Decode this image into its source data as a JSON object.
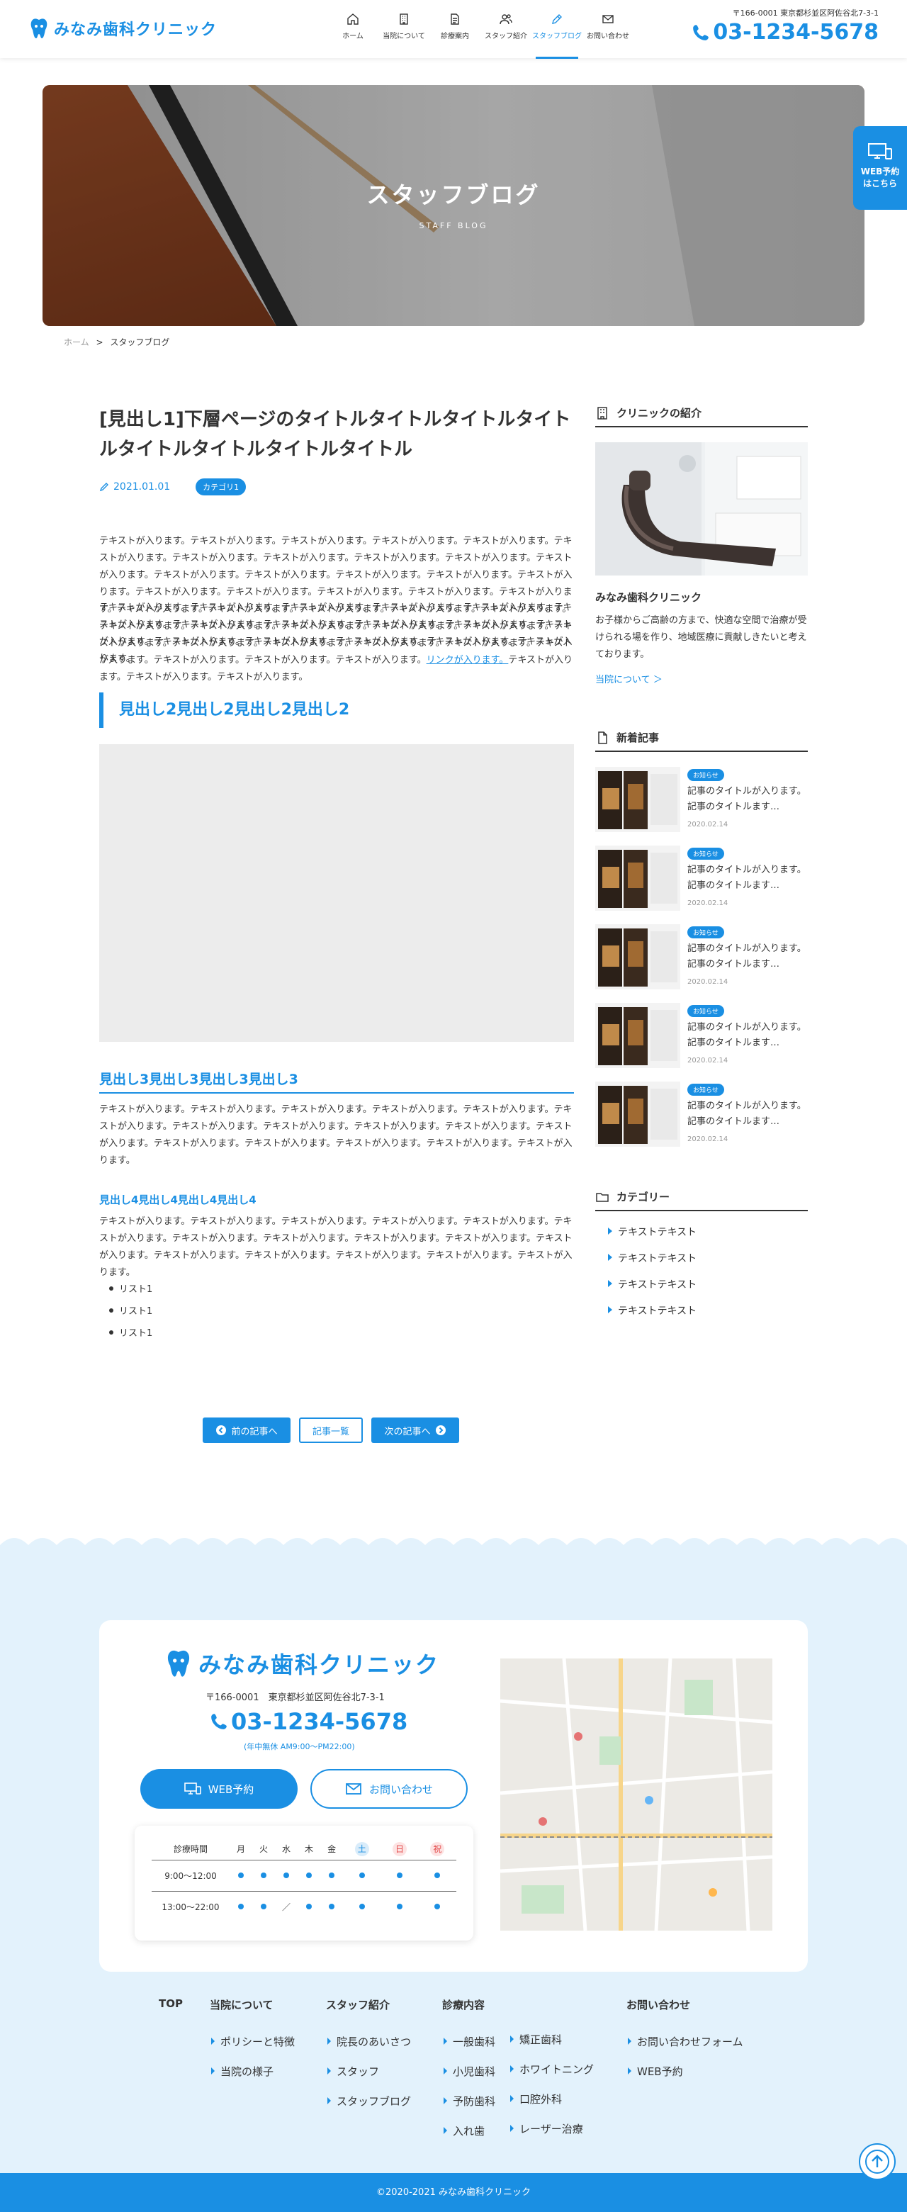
{
  "header": {
    "logo_text": "みなみ歯科クリニック",
    "nav": [
      {
        "label": "ホーム",
        "icon": "home-icon"
      },
      {
        "label": "当院について",
        "icon": "building-icon"
      },
      {
        "label": "診療案内",
        "icon": "document-icon"
      },
      {
        "label": "スタッフ紹介",
        "icon": "users-icon"
      },
      {
        "label": "スタッフブログ",
        "icon": "pen-icon",
        "active": true
      },
      {
        "label": "お問い合わせ",
        "icon": "mail-icon"
      }
    ],
    "address": "〒166-0001 東京都杉並区阿佐谷北7-3-1",
    "tel": "03-1234-5678"
  },
  "web_tab": {
    "line1": "WEB予約",
    "line2": "はこちら"
  },
  "hero": {
    "title": "スタッフブログ",
    "subtitle": "STAFF BLOG"
  },
  "breadcrumb": {
    "home": "ホーム",
    "sep": ">",
    "current": "スタッフブログ"
  },
  "article": {
    "title": "[見出し1]下層ページのタイトルタイトルタイトルタイトルタイトルタイトルタイトルタイトル",
    "date": "2021.01.01",
    "category": "カテゴリ1",
    "para1_a": "テキストが入ります。テキストが入ります。テキストが入ります。テキストが入ります。テキストが入ります。テキストが入ります。テキストが入ります。テキストが入ります。テキストが入ります。テキストが入ります。テキストが入ります。テキストが入ります。テキストが入ります。テキストが入ります。テキストが入ります。テキストが入ります。テキストが入ります。テキストが入ります。テキストが入ります。テキストが入ります。テキストが入ります。テキストが入ります。テキストが入ります。テキストが入ります。テキストが入ります。テキストが入ります。テキストが入ります。テキストが入ります。テキストが入ります。テキストが入ります。テキストが入ります。テキストが入ります。テキストが入ります。テキストが入ります。テキストが入ります。テキストが入ります。テキストが入ります。テキストが入ります。テキストが入ります。テキストが入ります。",
    "link_text": "リンクが入ります。",
    "para1_b": "テキストが入ります。テキストが入ります。テキストが入ります。",
    "para2": "テキストが入ります。テキストが入ります。テキストが入ります。テキストが入ります。テキストが入ります。テキストが入ります。テキストが入ります。テキストが入ります。テキストが入ります。テキストが入ります。テキストが入ります。テキストが入ります。テキストが入ります。テキストが入ります。テキストが入ります。テキストが入ります。",
    "h2": "見出し2見出し2見出し2見出し2",
    "h3": "見出し3見出し3見出し3見出し3",
    "para3": "テキストが入ります。テキストが入ります。テキストが入ります。テキストが入ります。テキストが入ります。テキストが入ります。テキストが入ります。テキストが入ります。テキストが入ります。テキストが入ります。テキストが入ります。テキストが入ります。テキストが入ります。テキストが入ります。テキストが入ります。テキストが入ります。",
    "h4": "見出し4見出し4見出し4見出し4",
    "para4": "テキストが入ります。テキストが入ります。テキストが入ります。テキストが入ります。テキストが入ります。テキストが入ります。テキストが入ります。テキストが入ります。テキストが入ります。テキストが入ります。テキストが入ります。テキストが入ります。テキストが入ります。テキストが入ります。テキストが入ります。テキストが入ります。",
    "list": [
      "リスト1",
      "リスト1",
      "リスト1"
    ]
  },
  "pager": {
    "prev": "前の記事へ",
    "list": "記事一覧",
    "next": "次の記事へ"
  },
  "sidebar": {
    "clinic_heading": "クリニックの紹介",
    "clinic_name": "みなみ歯科クリニック",
    "clinic_desc": "お子様からご高齢の方まで、快適な空間で治療が受けられる場を作り、地域医療に貢献しきたいと考えております。",
    "clinic_link": "当院について ＞",
    "news_heading": "新着記事",
    "news": [
      {
        "badge": "お知らせ",
        "title": "記事のタイトルが入ります。記事のタイトルます…",
        "date": "2020.02.14"
      },
      {
        "badge": "お知らせ",
        "title": "記事のタイトルが入ります。記事のタイトルます…",
        "date": "2020.02.14"
      },
      {
        "badge": "お知らせ",
        "title": "記事のタイトルが入ります。記事のタイトルます…",
        "date": "2020.02.14"
      },
      {
        "badge": "お知らせ",
        "title": "記事のタイトルが入ります。記事のタイトルます…",
        "date": "2020.02.14"
      },
      {
        "badge": "お知らせ",
        "title": "記事のタイトルが入ります。記事のタイトルます…",
        "date": "2020.02.14"
      }
    ],
    "cat_heading": "カテゴリー",
    "categories": [
      "テキストテキスト",
      "テキストテキスト",
      "テキストテキスト",
      "テキストテキスト"
    ]
  },
  "footer": {
    "logo_text": "みなみ歯科クリニック",
    "address": "〒166-0001　東京都杉並区阿佐谷北7-3-1",
    "tel": "03-1234-5678",
    "hours_note": "(年中無休 AM9:00〜PM22:00)",
    "web_button": "WEB予約",
    "contact_button": "お問い合わせ",
    "table_headers": [
      "診療時間",
      "月",
      "火",
      "水",
      "木",
      "金",
      "土",
      "日",
      "祝"
    ],
    "rows": [
      {
        "time": "9:00〜12:00",
        "cells": [
          "●",
          "●",
          "●",
          "●",
          "●",
          "●",
          "●",
          "●"
        ]
      },
      {
        "time": "13:00〜22:00",
        "cells": [
          "●",
          "●",
          "／",
          "●",
          "●",
          "●",
          "●",
          "●"
        ]
      }
    ],
    "nav": {
      "top": "TOP",
      "about": {
        "heading": "当院について",
        "items": [
          "ポリシーと特徴",
          "当院の様子"
        ]
      },
      "staff": {
        "heading": "スタッフ紹介",
        "items": [
          "院長のあいさつ",
          "スタッフ",
          "スタッフブログ"
        ]
      },
      "treatment": {
        "heading": "診療内容",
        "col1": [
          "一般歯科",
          "小児歯科",
          "予防歯科",
          "入れ歯"
        ],
        "col2": [
          "矯正歯科",
          "ホワイトニング",
          "口腔外科",
          "レーザー治療"
        ]
      },
      "contact": {
        "heading": "お問い合わせ",
        "items": [
          "お問い合わせフォーム",
          "WEB予約"
        ]
      }
    },
    "copyright": "©2020-2021 みなみ歯科クリニック"
  },
  "colors": {
    "accent": "#1a8fe3",
    "footer_bg": "#e3f2fc"
  }
}
